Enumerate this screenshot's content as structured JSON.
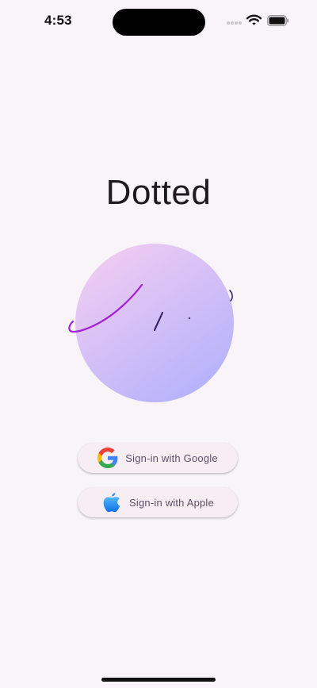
{
  "status_bar": {
    "time": "4:53"
  },
  "app": {
    "title": "Dotted"
  },
  "buttons": {
    "google": {
      "label": "Sign-in with Google",
      "icon": "google-logo-icon"
    },
    "apple": {
      "label": "Sign-in with Apple",
      "icon": "apple-logo-icon"
    }
  },
  "colors": {
    "background": "#f9f4f8",
    "button_background": "#f6eef3",
    "button_text": "#5b5067",
    "circle_gradient_start": "#eecbf2",
    "circle_gradient_end": "#b4b2fb",
    "stroke_purple": "#a31fd6",
    "stroke_dark": "#3e2470"
  }
}
